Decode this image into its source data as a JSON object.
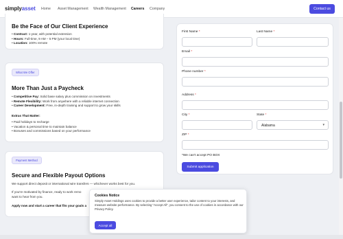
{
  "nav": {
    "logo_main": "simply",
    "logo_accent": "asset",
    "links": [
      "Home",
      "Asset Management",
      "Wealth Management",
      "Careers",
      "Company"
    ],
    "active": "Careers",
    "contact_label": "Contact us"
  },
  "card1": {
    "title": "Be the Face of Our Client Experience",
    "items": [
      {
        "label": "Contract:",
        "text": " 1-year, with potential extension"
      },
      {
        "label": "Hours:",
        "text": " Full-time, 9 AM – 5 PM (your local time)"
      },
      {
        "label": "Location:",
        "text": " 100% remote"
      }
    ]
  },
  "card2": {
    "pill": "What We Offer",
    "title": "More Than Just a Paycheck",
    "items": [
      {
        "label": "Competitive Pay:",
        "text": " Solid base salary plus commission on investments"
      },
      {
        "label": "Remote Flexibility:",
        "text": " Work from anywhere with a reliable internet connection"
      },
      {
        "label": "Career Development:",
        "text": " Free, in-depth training and support to grow your skills"
      }
    ],
    "extras_title": "Extras That Matter:",
    "extras": [
      "• Paid holidays to recharge",
      "• Vacation & personal time to maintain balance",
      "• Bonuses and commissions based on your performance"
    ]
  },
  "card3": {
    "pill": "Payment Method",
    "title": "Secure and Flexible Payout Options",
    "p1": "We support direct deposit or international wire transfers — whichever works best for you.",
    "p2a": "If you're motivated by finance, ready to work remo",
    "p2b": "want to hear from you.",
    "p3": "Apply now and start a career that fits your goals a"
  },
  "form": {
    "first_name": "First Name",
    "last_name": "Last Name",
    "email": "Email",
    "phone": "Phone number",
    "address": "Address",
    "city": "City",
    "state": "State",
    "state_value": "Alabama",
    "zip": "ZIP",
    "req": "*",
    "pobox": "*We can't accept PO BOX",
    "submit": "Submit application"
  },
  "cookie": {
    "title": "Cookies Notice",
    "text": "Simply Asset Holdings uses cookies to provide a better user experience, tailor content to your interests, and measure website performance. By selecting \"Accept All\", you consent to the use of cookies in accordance with our Privacy Policy.",
    "accept": "Accept all"
  },
  "colors": {
    "accent": "#4b4be0",
    "background": "#eef0f4"
  }
}
